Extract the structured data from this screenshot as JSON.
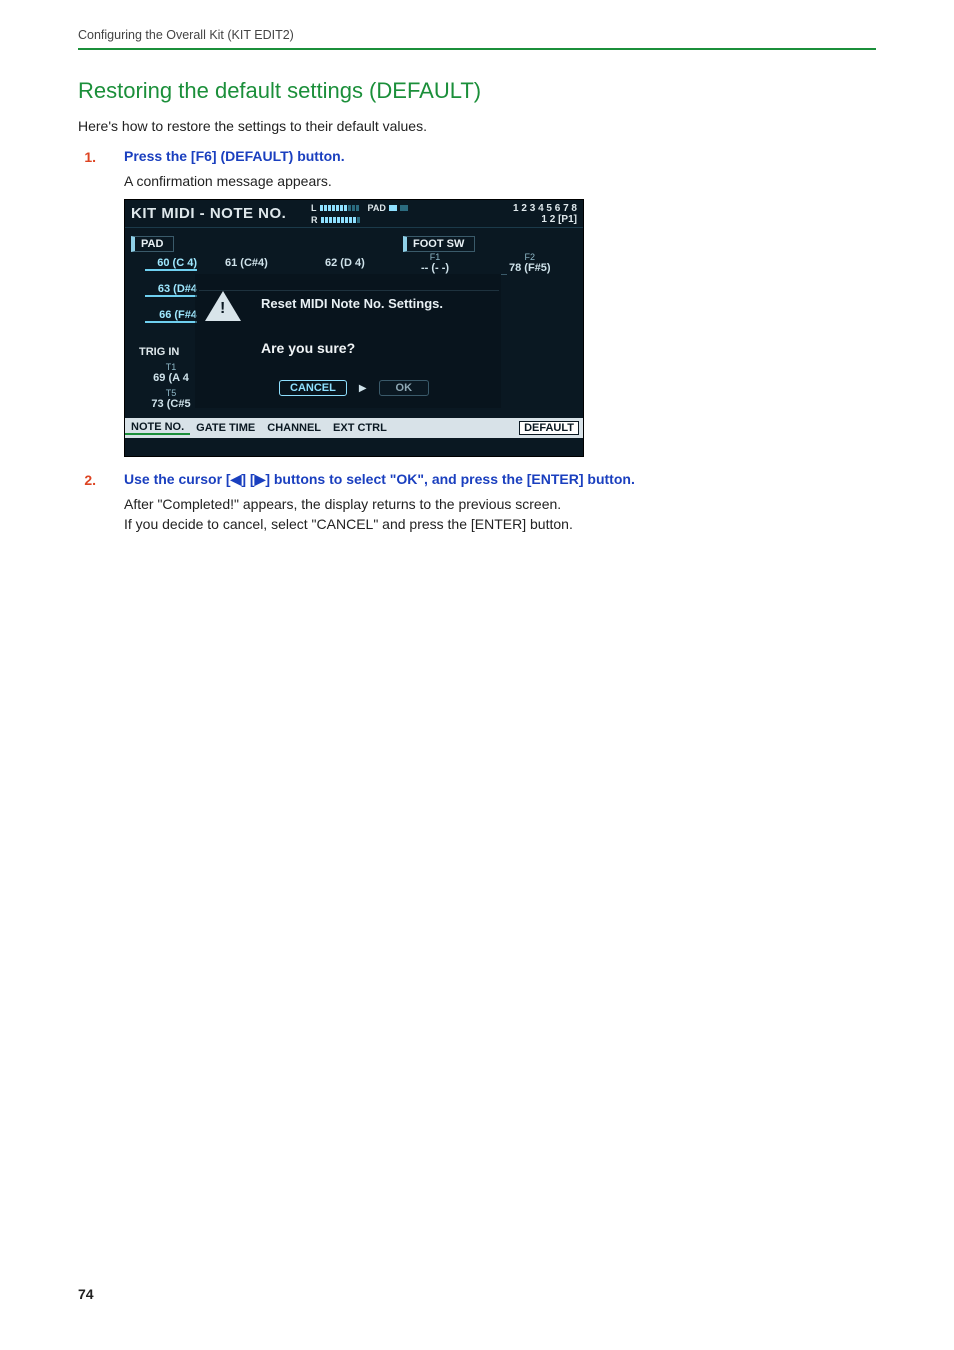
{
  "running_head": "Configuring the Overall Kit (KIT EDIT2)",
  "section_title": "Restoring the default settings (DEFAULT)",
  "intro": "Here's how to restore the settings to their default values.",
  "steps": [
    {
      "num": "1.",
      "text": "Press the [F6] (DEFAULT) button.",
      "body": "A confirmation message appears."
    },
    {
      "num": "2.",
      "text": "Use the cursor [◀] [▶] buttons to select \"OK\", and press the [ENTER] button.",
      "body1": "After \"Completed!\" appears, the display returns to the previous screen.",
      "body2": "If you decide to cancel, select \"CANCEL\" and press the [ENTER] button."
    }
  ],
  "screen": {
    "title": "KIT MIDI - NOTE NO.",
    "meter_L_label": "L",
    "meter_R_label": "R",
    "pad_label": "PAD",
    "slots_line1": "1 2 3 4 5 6 7 8",
    "slots_line2": "1 2 [P1]",
    "tab_pad": "PAD",
    "tab_footsw": "FOOT SW",
    "cells": {
      "c60": "60 (C 4)",
      "c61": "61 (C#4)",
      "c62": "62 (D 4)",
      "f1_label": "F1",
      "f1_val": "-- (- -)",
      "f2_label": "F2",
      "f2_val": "78 (F#5)",
      "c63": "63 (D#4",
      "c66": "66 (F#4",
      "trigin": "TRIG IN",
      "t1_label": "T1",
      "t1_val": "69 (A 4",
      "t5_label": "T5",
      "t5_val": "73 (C#5"
    },
    "dialog": {
      "msg": "Reset MIDI Note No. Settings.",
      "q": "Are you sure?",
      "cancel": "CANCEL",
      "arrow": "▶",
      "ok": "OK"
    },
    "foot": {
      "noteno": "NOTE NO.",
      "gatetime": "GATE TIME",
      "channel": "CHANNEL",
      "extctrl": "EXT CTRL",
      "default": "DEFAULT"
    }
  },
  "page_number": "74"
}
